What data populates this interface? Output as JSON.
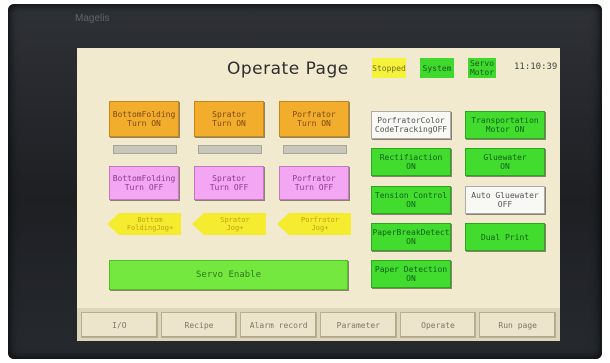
{
  "device": {
    "brand": "Magelis"
  },
  "header": {
    "title": "Operate Page",
    "indicators": {
      "stopped": "Stopped",
      "system": "System",
      "servo": "Servo\nMotor"
    },
    "clock": "11:10:39"
  },
  "buttons": {
    "bottom_folding_on": "BottomFolding\nTurn ON",
    "sprator_on": "Sprator\nTurn ON",
    "porfrator_on": "Porfrator\nTurn ON",
    "bottom_folding_off": "BottomFolding\nTurn OFF",
    "sprator_off": "Sprator\nTurn OFF",
    "porfrator_off": "Porfrator\nTurn OFF",
    "bottom_folding_jog": "Bottom\nFoldingJog+",
    "sprator_jog": "Sprator\nJog+",
    "porfrator_jog": "Porfrator\nJog+",
    "servo_enable": "Servo Enable",
    "porfrator_color": "PorfratorColor\nCodeTrackingOFF",
    "transportation_motor": "Transportation\nMotor ON",
    "rectifiaction": "Rectifiaction\nON",
    "gluewater": "Gluewater\nON",
    "tension_control": "Tension Control\nON",
    "auto_gluewater": "Auto Gluewater\nOFF",
    "paper_break_detect": "PaperBreakDetect\nON",
    "dual_print": "Dual Print",
    "paper_detection": "Paper Detection\nON"
  },
  "tabs": [
    "I/O",
    "Recipe",
    "Alarm record",
    "Parameter",
    "Operate",
    "Run page"
  ]
}
